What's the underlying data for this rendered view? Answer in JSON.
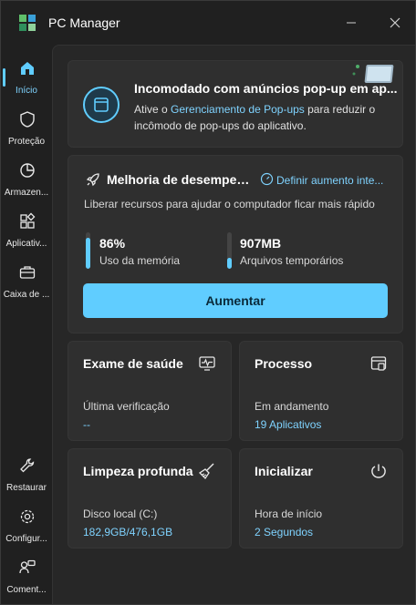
{
  "window": {
    "title": "PC Manager",
    "minimize_icon": "minimize-icon",
    "close_icon": "close-icon"
  },
  "sidebar": {
    "items": [
      {
        "label": "Início",
        "icon": "home-icon",
        "active": true
      },
      {
        "label": "Proteção",
        "icon": "shield-icon"
      },
      {
        "label": "Armazen...",
        "icon": "pie-chart-icon"
      },
      {
        "label": "Aplicativ...",
        "icon": "apps-icon"
      },
      {
        "label": "Caixa de ...",
        "icon": "toolbox-icon"
      }
    ],
    "bottom_items": [
      {
        "label": "Restaurar",
        "icon": "wrench-icon"
      },
      {
        "label": "Configur...",
        "icon": "gear-icon"
      },
      {
        "label": "Coment...",
        "icon": "feedback-icon"
      }
    ]
  },
  "promo": {
    "title": "Incomodado com anúncios pop-up em ap...",
    "text_before": "Ative o ",
    "link": "Gerenciamento de Pop-ups",
    "text_after": " para reduzir o incômodo de pop-ups do aplicativo."
  },
  "performance": {
    "title": "Melhoria de desempen...",
    "link": "Definir aumento inte...",
    "subtitle": "Liberar recursos para ajudar o computador ficar mais rápido",
    "memory": {
      "value": "86%",
      "label": "Uso da memória",
      "level": 0.86
    },
    "temp": {
      "value": "907MB",
      "label": "Arquivos temporários",
      "level": 0.3
    },
    "button": "Aumentar",
    "accent": "#60cdff"
  },
  "tiles": [
    {
      "title": "Exame de saúde",
      "icon": "health-monitor-icon",
      "label": "Última verificação",
      "value": "--"
    },
    {
      "title": "Processo",
      "icon": "process-window-icon",
      "label": "Em andamento",
      "value": "19 Aplicativos"
    },
    {
      "title": "Limpeza profunda",
      "icon": "broom-icon",
      "label": "Disco local (C:)",
      "value": "182,9GB/476,1GB"
    },
    {
      "title": "Inicializar",
      "icon": "power-icon",
      "label": "Hora de início",
      "value": "2 Segundos"
    }
  ]
}
